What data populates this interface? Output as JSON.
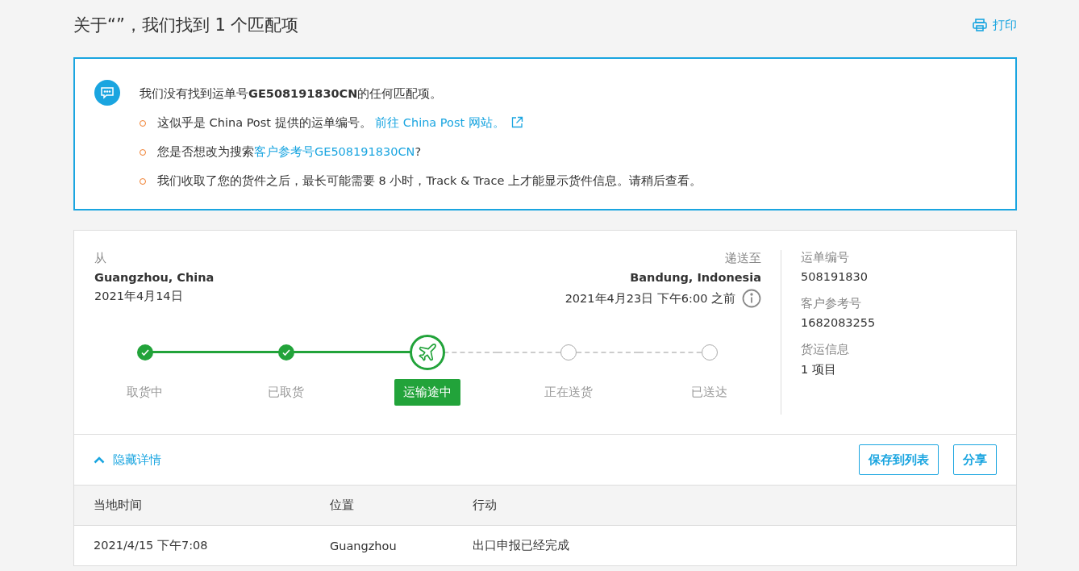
{
  "header": {
    "title": "关于“”，我们找到 1 个匹配项",
    "print": "打印"
  },
  "notice": {
    "message": "我们没有找到运单号**GE508191830CN**的任何匹配项。",
    "bullets": [
      {
        "text": "这似乎是 China Post 提供的运单编号。 ",
        "link": "前往 China Post 网站。",
        "external": true
      },
      {
        "text": "您是否想改为搜索",
        "link": "客户参考号GE508191830CN",
        "suffix": "?",
        "external": false
      },
      {
        "text": "我们收取了您的货件之后，最长可能需要 8 小时，Track & Trace 上才能显示货件信息。请稍后查看。",
        "external": false
      }
    ]
  },
  "shipment": {
    "from": {
      "label": "从",
      "city": "Guangzhou, China",
      "date": "2021年4月14日"
    },
    "to": {
      "label": "递送至",
      "city": "Bandung, Indonesia",
      "date": "2021年4月23日 下午6:00 之前"
    },
    "steps": [
      {
        "label": "取货中",
        "completed": true,
        "current": false
      },
      {
        "label": "已取货",
        "completed": true,
        "current": false
      },
      {
        "label": "运输途中",
        "completed": false,
        "current": true
      },
      {
        "label": "正在送货",
        "completed": false,
        "current": false
      },
      {
        "label": "已送达",
        "completed": false,
        "current": false
      }
    ],
    "info": [
      {
        "label": "运单编号",
        "value": "508191830"
      },
      {
        "label": "客户参考号",
        "value": "1682083255"
      },
      {
        "label": "货运信息",
        "value": "1 项目"
      }
    ]
  },
  "details": {
    "toggle": "隐藏详情",
    "expanded": true,
    "buttons": [
      "保存到列表",
      "分享"
    ],
    "columns": [
      "当地时间",
      "位置",
      "行动"
    ],
    "rows": [
      [
        "2021/4/15 下午7:08",
        "Guangzhou",
        "出口申报已经完成"
      ]
    ]
  }
}
